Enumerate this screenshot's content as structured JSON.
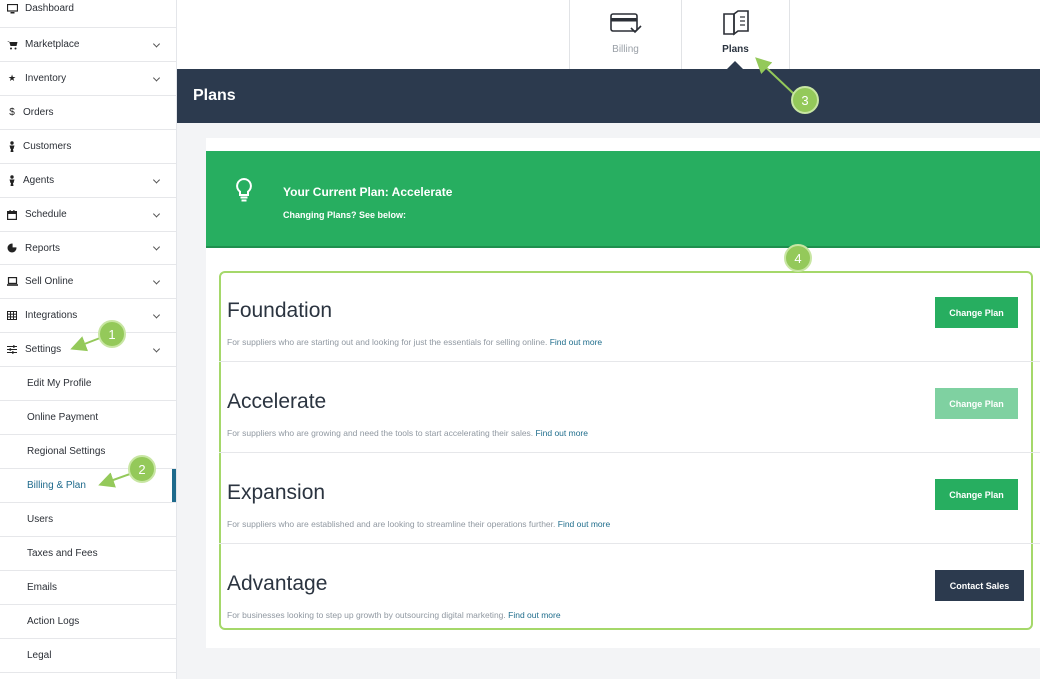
{
  "sidebar": {
    "items": [
      {
        "label": "Dashboard",
        "icon": "monitor-icon",
        "expandable": false
      },
      {
        "label": "Marketplace",
        "icon": "cart-icon",
        "expandable": true
      },
      {
        "label": "Inventory",
        "icon": "star-icon",
        "expandable": true
      },
      {
        "label": "Orders",
        "icon": "dollar-icon",
        "expandable": false
      },
      {
        "label": "Customers",
        "icon": "person-icon",
        "expandable": false
      },
      {
        "label": "Agents",
        "icon": "person-icon",
        "expandable": true
      },
      {
        "label": "Schedule",
        "icon": "calendar-icon",
        "expandable": true
      },
      {
        "label": "Reports",
        "icon": "pie-chart-icon",
        "expandable": true
      },
      {
        "label": "Sell Online",
        "icon": "laptop-icon",
        "expandable": true
      },
      {
        "label": "Integrations",
        "icon": "grid-icon",
        "expandable": true
      },
      {
        "label": "Settings",
        "icon": "sliders-icon",
        "expandable": true
      }
    ],
    "subitems": [
      {
        "label": "Edit My Profile"
      },
      {
        "label": "Online Payment"
      },
      {
        "label": "Regional Settings"
      },
      {
        "label": "Billing & Plan",
        "active": true
      },
      {
        "label": "Users"
      },
      {
        "label": "Taxes and Fees"
      },
      {
        "label": "Emails"
      },
      {
        "label": "Action Logs"
      },
      {
        "label": "Legal"
      }
    ]
  },
  "tabs": [
    {
      "label": "Billing",
      "icon": "credit-card-icon",
      "active": false
    },
    {
      "label": "Plans",
      "icon": "book-icon",
      "active": true
    }
  ],
  "header": {
    "title": "Plans"
  },
  "current_plan": {
    "title": "Your Current Plan: Accelerate",
    "subtitle": "Changing Plans? See below:",
    "icon": "lightbulb-icon"
  },
  "plans": [
    {
      "name": "Foundation",
      "description": "For suppliers who are starting out and looking for just the essentials for selling online.",
      "link": "Find out more",
      "button": "Change Plan",
      "style": "green"
    },
    {
      "name": "Accelerate",
      "description": "For suppliers who are growing and need the tools to start accelerating their sales.",
      "link": "Find out more",
      "button": "Change Plan",
      "style": "disabled"
    },
    {
      "name": "Expansion",
      "description": "For suppliers who are established and are looking to streamline their operations further.",
      "link": "Find out more",
      "button": "Change Plan",
      "style": "green"
    },
    {
      "name": "Advantage",
      "description": "For businesses looking to step up growth by outsourcing digital marketing.",
      "link": "Find out more",
      "button": "Contact Sales",
      "style": "dark"
    }
  ],
  "annotations": [
    "1",
    "2",
    "3",
    "4"
  ],
  "colors": {
    "primary_green": "#27ae60",
    "navy": "#2c3a4e",
    "accent_blue": "#1e6a8c",
    "annotation_green": "#94c95a"
  }
}
